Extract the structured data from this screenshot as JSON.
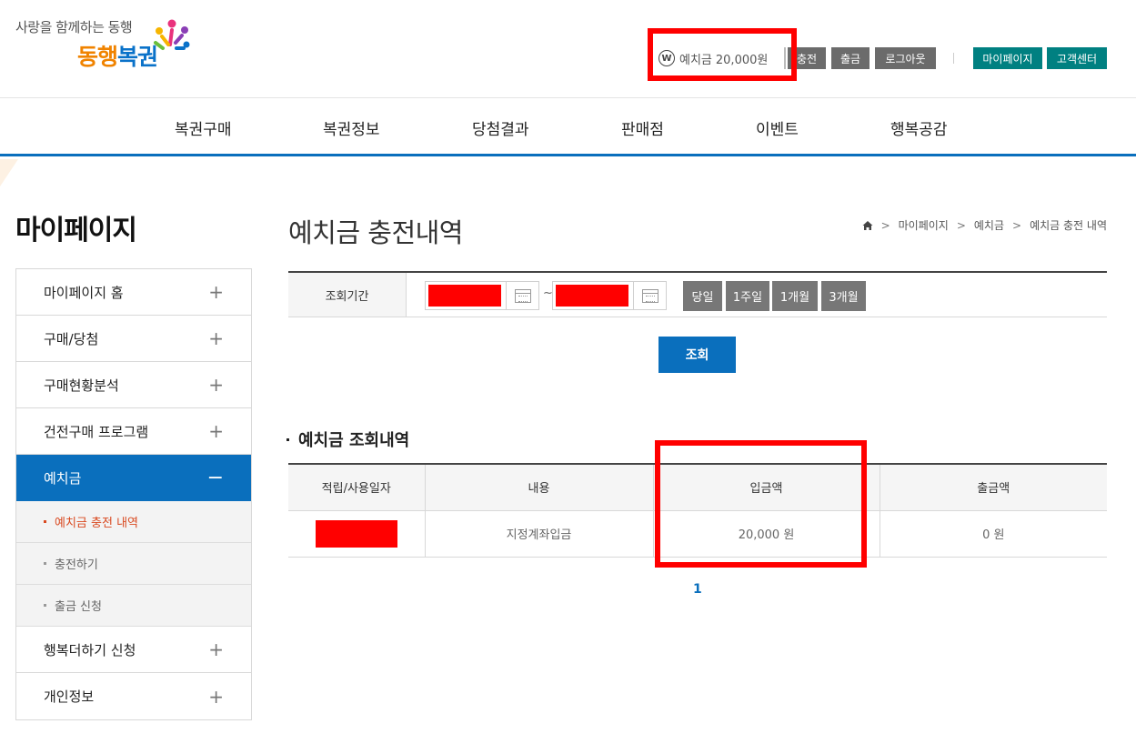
{
  "header": {
    "slogan": "사랑을 함께하는 동행",
    "brand_part1": "동행",
    "brand_part2": "복권",
    "deposit_icon": "W",
    "deposit_label": "예치금",
    "deposit_amount": "20,000원",
    "buttons": {
      "charge": "충전",
      "withdraw": "출금",
      "logout": "로그아웃",
      "mypage": "마이페이지",
      "customer_center": "고객센터"
    }
  },
  "nav": {
    "items": [
      "복권구매",
      "복권정보",
      "당첨결과",
      "판매점",
      "이벤트",
      "행복공감"
    ]
  },
  "sidebar": {
    "title": "마이페이지",
    "items": [
      {
        "label": "마이페이지 홈",
        "toggle": "+"
      },
      {
        "label": "구매/당첨",
        "toggle": "+"
      },
      {
        "label": "구매현황분석",
        "toggle": "+"
      },
      {
        "label": "건전구매 프로그램",
        "toggle": "+"
      },
      {
        "label": "예치금",
        "toggle": "−"
      },
      {
        "label": "행복더하기 신청",
        "toggle": "+"
      },
      {
        "label": "개인정보",
        "toggle": "+"
      }
    ],
    "subitems": [
      "예치금 충전 내역",
      "충전하기",
      "출금 신청"
    ]
  },
  "main": {
    "title": "예치금 충전내역",
    "breadcrumb": [
      "마이페이지",
      "예치금",
      "예치금 충전 내역"
    ],
    "search": {
      "label": "조회기간",
      "start_date": "",
      "end_date": "",
      "tilde": "~",
      "periods": [
        "당일",
        "1주일",
        "1개월",
        "3개월"
      ],
      "submit": "조회"
    },
    "section_title": "예치금 조회내역",
    "table": {
      "headers": [
        "적립/사용일자",
        "내용",
        "입금액",
        "출금액"
      ],
      "rows": [
        {
          "date": "",
          "content": "지정계좌입금",
          "deposit": "20,000 원",
          "withdraw": "0 원"
        }
      ]
    },
    "pagination": [
      "1"
    ]
  },
  "colors": {
    "primary": "#0a6fbd",
    "teal": "#008081",
    "gray_button": "#6b6b6b",
    "highlight": "#ff0000",
    "current_sub": "#d94a21"
  }
}
